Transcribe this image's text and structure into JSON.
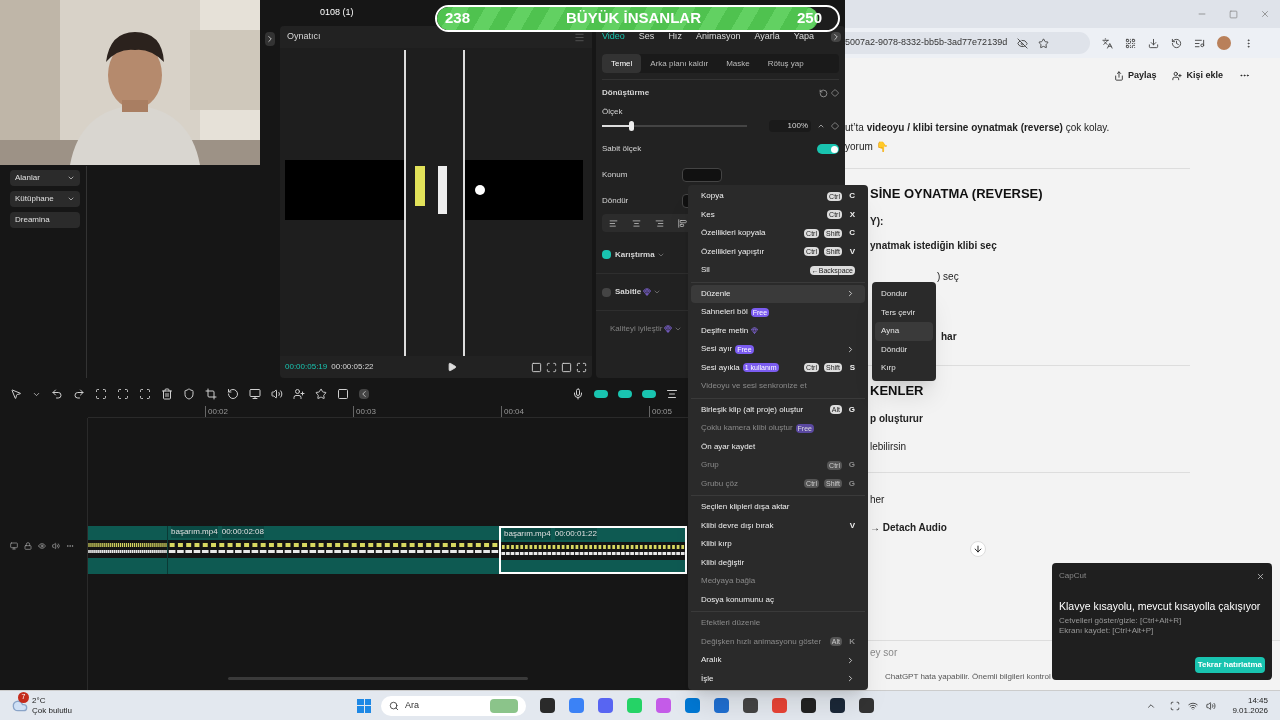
{
  "capcut": {
    "title": "0108 (1)",
    "sidebar": [
      {
        "label": "Alanlar",
        "kind": "dropdown"
      },
      {
        "label": "Kütüphane",
        "kind": "dropdown"
      },
      {
        "label": "Dreamina",
        "kind": "link"
      }
    ],
    "player": {
      "title": "Oynatıcı",
      "current_time": "00:00:05:19",
      "total_time": "00:00:05:22"
    },
    "inspector": {
      "tabs": [
        {
          "label": "Video",
          "selected": true
        },
        {
          "label": "Ses",
          "selected": false
        },
        {
          "label": "Hız",
          "selected": false
        },
        {
          "label": "Animasyon",
          "selected": false
        },
        {
          "label": "Ayarla",
          "selected": false
        },
        {
          "label": "Yapa",
          "selected": false
        }
      ],
      "subtabs": [
        {
          "label": "Temel",
          "selected": true
        },
        {
          "label": "Arka planı kaldır",
          "selected": false
        },
        {
          "label": "Maske",
          "selected": false
        },
        {
          "label": "Rötuş yap",
          "selected": false
        }
      ],
      "section": "Dönüştürme",
      "scale": {
        "label": "Ölçek",
        "level": 0.2,
        "value": "100%"
      },
      "uniform_scale": {
        "label": "Sabit ölçek",
        "on": true
      },
      "position_label": "Konum",
      "rotate_label": "Döndür",
      "options": [
        {
          "label": "Karıştırma",
          "kind": "checkbox",
          "checked": true
        },
        {
          "label": "Sabitle",
          "kind": "checkbox-pro",
          "checked": false
        },
        {
          "label": "Kaliteyi iyileştir",
          "kind": "disabled-pro"
        }
      ]
    },
    "ruler": [
      "00:02",
      "00:03",
      "00:04",
      "00:05"
    ],
    "clips": [
      {
        "name": "başarım.mp4",
        "duration": "00:00:02:08",
        "selected": false
      },
      {
        "name": "başarım.mp4",
        "duration": "00:00:01:22",
        "selected": true
      }
    ]
  },
  "goal_bar": {
    "current": "238",
    "title": "BÜYÜK İNSANLAR",
    "target": "250",
    "level": 0.95
  },
  "context_menu": [
    {
      "kind": "item",
      "label": "Kopya",
      "keys": [
        "Ctrl"
      ],
      "key": "C",
      "selected": false,
      "disabled": false
    },
    {
      "kind": "item",
      "label": "Kes",
      "keys": [
        "Ctrl"
      ],
      "key": "X",
      "selected": false,
      "disabled": false
    },
    {
      "kind": "item",
      "label": "Özellikleri kopyala",
      "keys": [
        "Ctrl",
        "Shift"
      ],
      "key": "C",
      "selected": false,
      "disabled": false
    },
    {
      "kind": "item",
      "label": "Özellikleri yapıştır",
      "keys": [
        "Ctrl",
        "Shift"
      ],
      "key": "V",
      "selected": false,
      "disabled": false
    },
    {
      "kind": "item",
      "label": "Sil",
      "keys": [
        "←Backspace"
      ],
      "selected": false,
      "disabled": false
    },
    {
      "kind": "separator"
    },
    {
      "kind": "item",
      "label": "Düzenle",
      "submenu": true,
      "selected": true,
      "disabled": false
    },
    {
      "kind": "item",
      "label": "Sahneleri böl",
      "badge": {
        "kind": "free",
        "text": "Free"
      },
      "selected": false,
      "disabled": false
    },
    {
      "kind": "item",
      "label": "Deşifre metin",
      "badge": {
        "kind": "gem"
      },
      "selected": false,
      "disabled": false
    },
    {
      "kind": "item",
      "label": "Sesi ayır",
      "badge": {
        "kind": "free",
        "text": "Free"
      },
      "submenu": true,
      "selected": false,
      "disabled": false
    },
    {
      "kind": "item",
      "label": "Sesi ayıkla",
      "badge": {
        "kind": "free",
        "text": "1 kullanım"
      },
      "keys": [
        "Ctrl",
        "Shift"
      ],
      "key": "S",
      "selected": false,
      "disabled": false
    },
    {
      "kind": "item",
      "label": "Videoyu ve sesi senkronize et",
      "selected": false,
      "disabled": true
    },
    {
      "kind": "separator"
    },
    {
      "kind": "item",
      "label": "Birleşik klip (alt proje) oluştur",
      "keys": [
        "Alt"
      ],
      "key": "G",
      "selected": false,
      "disabled": false
    },
    {
      "kind": "item",
      "label": "Çoklu kamera klibi oluştur",
      "badge": {
        "kind": "free",
        "text": "Free"
      },
      "selected": false,
      "disabled": true
    },
    {
      "kind": "item",
      "label": "Ön ayar kaydet",
      "selected": false,
      "disabled": false
    },
    {
      "kind": "item",
      "label": "Grup",
      "keys": [
        "Ctrl"
      ],
      "key": "G",
      "selected": false,
      "disabled": true
    },
    {
      "kind": "item",
      "label": "Grubu çöz",
      "keys": [
        "Ctrl",
        "Shift"
      ],
      "key": "G",
      "selected": false,
      "disabled": true
    },
    {
      "kind": "separator"
    },
    {
      "kind": "item",
      "label": "Seçilen klipleri dışa aktar",
      "selected": false,
      "disabled": false
    },
    {
      "kind": "item",
      "label": "Klibi devre dışı bırak",
      "key": "V",
      "selected": false,
      "disabled": false
    },
    {
      "kind": "item",
      "label": "Klibi kırp",
      "selected": false,
      "disabled": false
    },
    {
      "kind": "item",
      "label": "Klibi değiştir",
      "selected": false,
      "disabled": false
    },
    {
      "kind": "item",
      "label": "Medyaya bağla",
      "selected": false,
      "disabled": true
    },
    {
      "kind": "item",
      "label": "Dosya konumunu aç",
      "selected": false,
      "disabled": false
    },
    {
      "kind": "separator"
    },
    {
      "kind": "item",
      "label": "Efektleri düzenle",
      "selected": false,
      "disabled": true
    },
    {
      "kind": "item",
      "label": "Değişken hızlı animasyonu göster",
      "keys": [
        "Alt"
      ],
      "key": "K",
      "selected": false,
      "disabled": true
    },
    {
      "kind": "item",
      "label": "Aralık",
      "submenu": true,
      "selected": false,
      "disabled": false
    },
    {
      "kind": "item",
      "label": "İşle",
      "submenu": true,
      "selected": false,
      "disabled": false
    }
  ],
  "submenu": [
    {
      "label": "Dondur",
      "selected": false
    },
    {
      "label": "Ters çevir",
      "selected": false
    },
    {
      "label": "Ayna",
      "selected": true
    },
    {
      "label": "Döndür",
      "selected": false
    },
    {
      "label": "Kırp",
      "selected": false
    }
  ],
  "browser": {
    "url": "5007a2-9078-8332-bb5b-3ad77e72139d",
    "share": "Paylaş",
    "add_person": "Kişi ekle",
    "article": [
      {
        "kind": "lead",
        "text": "ut’ta **videoyu / klibi tersine oynatmak (reverse)** çok kolay."
      },
      {
        "kind": "lead",
        "text": "yorum 👇"
      },
      {
        "kind": "rule"
      },
      {
        "kind": "heading",
        "text": "SİNE OYNATMA (REVERSE)"
      },
      {
        "kind": "strong",
        "text": "Y):"
      },
      {
        "kind": "strong",
        "text": "ynatmak istediğin klibi seç"
      },
      {
        "kind": "tail",
        "text": ") seç"
      },
      {
        "kind": "tail-strong",
        "text": "har"
      },
      {
        "kind": "rule"
      },
      {
        "kind": "heading",
        "text": "KENLER"
      },
      {
        "kind": "strong",
        "text": "p oluşturur"
      },
      {
        "kind": "plain",
        "text": "lebilirsin"
      },
      {
        "kind": "rule"
      },
      {
        "kind": "plain",
        "text": "her"
      },
      {
        "kind": "strong",
        "text": "→ Detach Audio"
      }
    ],
    "prompt": "ey sor",
    "footer": "ChatGPT hata yapabilir. Önemli bilgileri kontrol"
  },
  "toast": {
    "app": "CapCut",
    "title": "Klavye kısayolu, mevcut kısayolla çakışıyor",
    "lines": [
      "Cetvelleri göster/gizle: [Ctrl+Alt+R]",
      "Ekranı kaydet: [Ctrl+Alt+P]"
    ],
    "button": "Tekrar hatırlatma"
  },
  "taskbar": {
    "weather_badge": "7",
    "temperature": "2°C",
    "weather": "Çok bulutlu",
    "search": "Ara",
    "time": "14:45",
    "date": "9.01.2026"
  }
}
